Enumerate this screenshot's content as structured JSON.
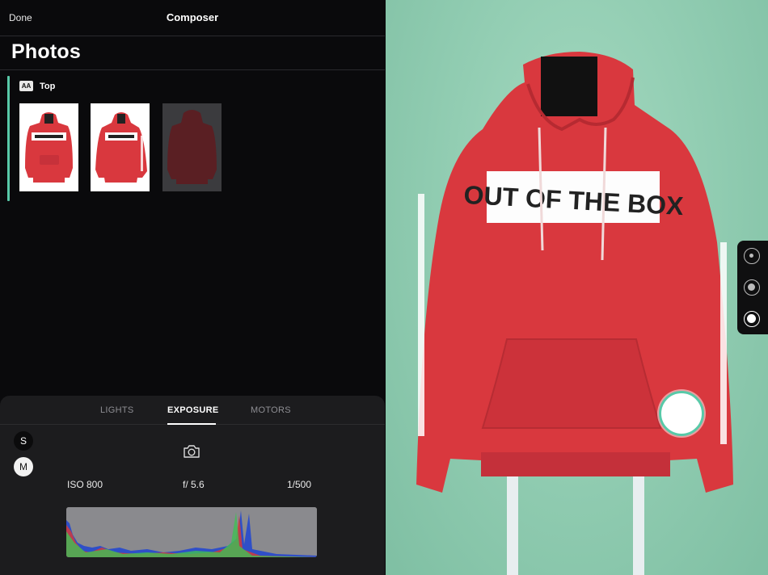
{
  "topbar": {
    "done_label": "Done",
    "title": "Composer"
  },
  "photos": {
    "title": "Photos",
    "section_badge": "AA",
    "section_label": "Top"
  },
  "panel": {
    "tabs": [
      {
        "label": "LIGHTS",
        "active": false
      },
      {
        "label": "EXPOSURE",
        "active": true
      },
      {
        "label": "MOTORS",
        "active": false
      }
    ],
    "mode_s": "S",
    "mode_m": "M",
    "iso": "ISO 800",
    "aperture": "f/ 5.6",
    "shutter": "1/500"
  },
  "preview": {
    "print_text": "OUT OF THE BOX"
  },
  "colors": {
    "accent": "#58c9a8",
    "hoodie": "#d9383e",
    "background": "#8fcbb0"
  },
  "icons": [
    "camera-icon",
    "side-option-small-icon",
    "side-option-medium-icon",
    "side-option-large-icon"
  ]
}
